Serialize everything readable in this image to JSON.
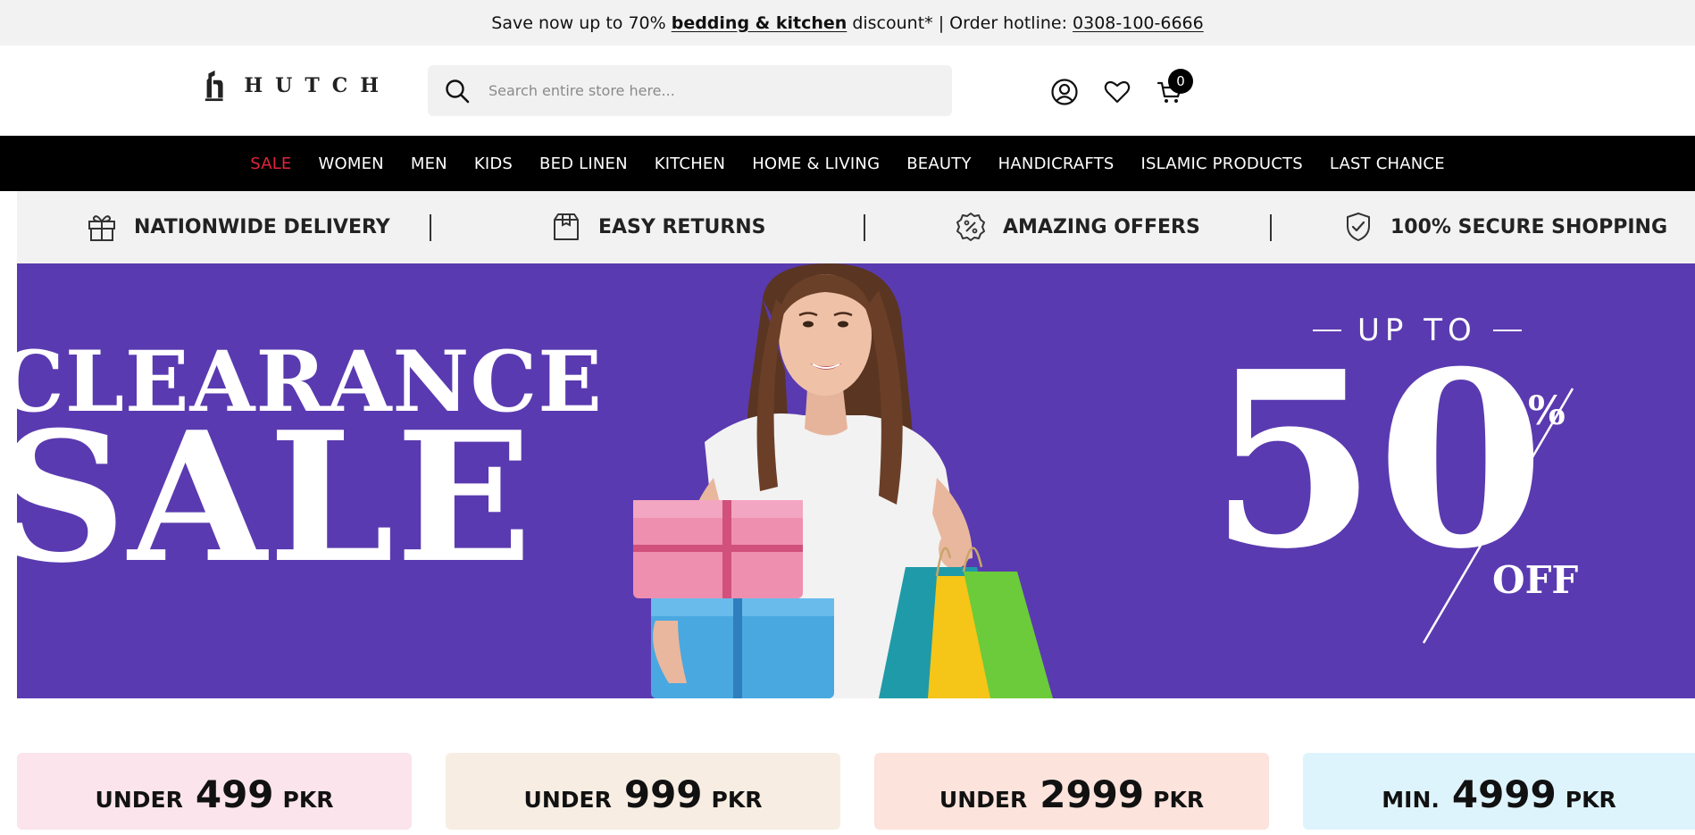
{
  "topbar": {
    "text_1": "Save now up to 70% ",
    "link_bedding": "bedding & kitchen",
    "text_2": " discount* | Order hotline: ",
    "hotline": "0308-100-6666"
  },
  "header": {
    "logo_text": "HUTCH",
    "search_placeholder": "Search entire store here...",
    "cart_count": "0",
    "icons": [
      "account-icon",
      "wishlist-heart-icon",
      "cart-icon",
      "search-icon"
    ]
  },
  "nav": {
    "items": [
      "SALE",
      "WOMEN",
      "MEN",
      "KIDS",
      "BED LINEN",
      "KITCHEN",
      "HOME & LIVING",
      "BEAUTY",
      "HANDICRAFTS",
      "ISLAMIC PRODUCTS",
      "LAST CHANCE"
    ],
    "sale_color": "#e0243b"
  },
  "features": [
    {
      "label": "NATIONWIDE DELIVERY",
      "icon": "gift-icon"
    },
    {
      "label": "EASY RETURNS",
      "icon": "box-icon"
    },
    {
      "label": "AMAZING OFFERS",
      "icon": "percent-badge-icon"
    },
    {
      "label": "100% SECURE SHOPPING",
      "icon": "shield-check-icon"
    }
  ],
  "hero": {
    "line1": "CLEARANCE",
    "line2": "SALE",
    "upto": "UP TO",
    "big_number": "50",
    "percent": "%",
    "off": "OFF",
    "background": "#5a3ab0"
  },
  "price_cards": [
    {
      "prefix": "UNDER",
      "amount": "499",
      "currency": "PKR",
      "bg": "#fbe4ec"
    },
    {
      "prefix": "UNDER",
      "amount": "999",
      "currency": "PKR",
      "bg": "#f7ede2"
    },
    {
      "prefix": "UNDER",
      "amount": "2999",
      "currency": "PKR",
      "bg": "#fce3dc"
    },
    {
      "prefix": "MIN.",
      "amount": "4999",
      "currency": "PKR",
      "bg": "#def4fc"
    }
  ]
}
